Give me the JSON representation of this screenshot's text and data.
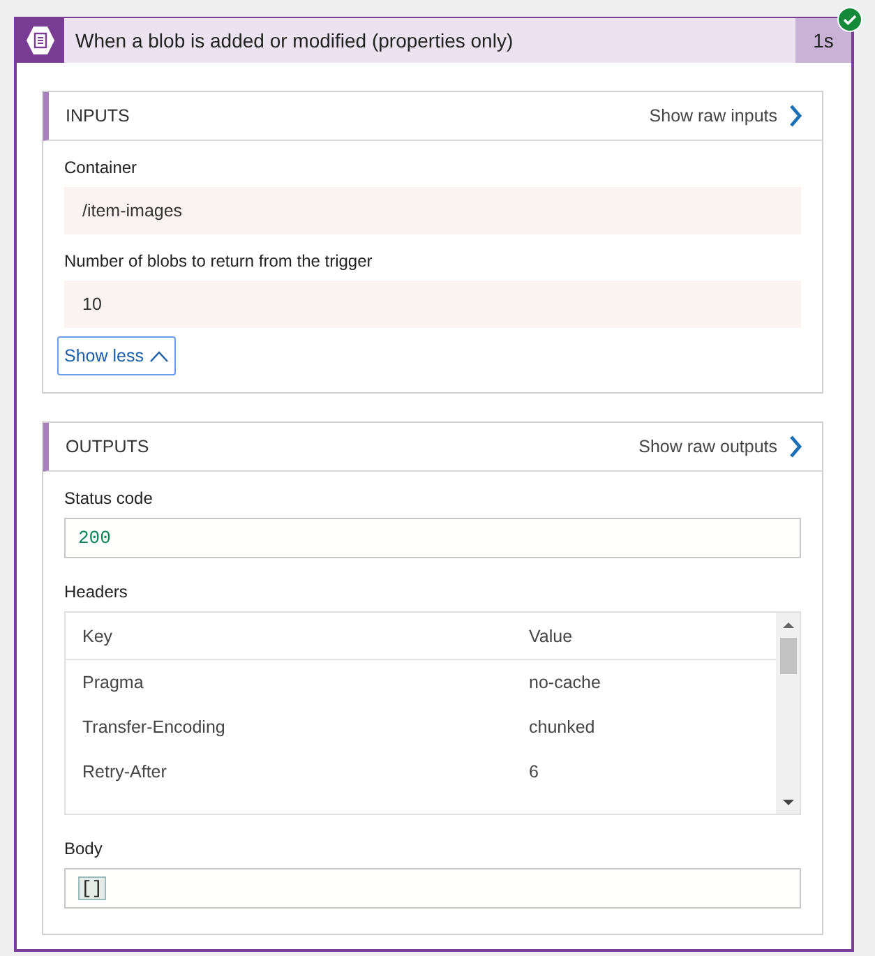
{
  "action": {
    "title": "When a blob is added or modified (properties only)",
    "duration": "1s",
    "succeeded": true
  },
  "inputs": {
    "heading": "INPUTS",
    "raw_link": "Show raw inputs",
    "fields": [
      {
        "label": "Container",
        "value": "/item-images"
      },
      {
        "label": "Number of blobs to return from the trigger",
        "value": "10"
      }
    ],
    "toggle": "Show less"
  },
  "outputs": {
    "heading": "OUTPUTS",
    "raw_link": "Show raw outputs",
    "status_label": "Status code",
    "status_value": "200",
    "headers_label": "Headers",
    "headers_columns": [
      "Key",
      "Value"
    ],
    "headers_rows": [
      {
        "key": "Pragma",
        "value": "no-cache"
      },
      {
        "key": "Transfer-Encoding",
        "value": "chunked"
      },
      {
        "key": "Retry-After",
        "value": "6"
      }
    ],
    "body_label": "Body",
    "body_value": "[]"
  }
}
